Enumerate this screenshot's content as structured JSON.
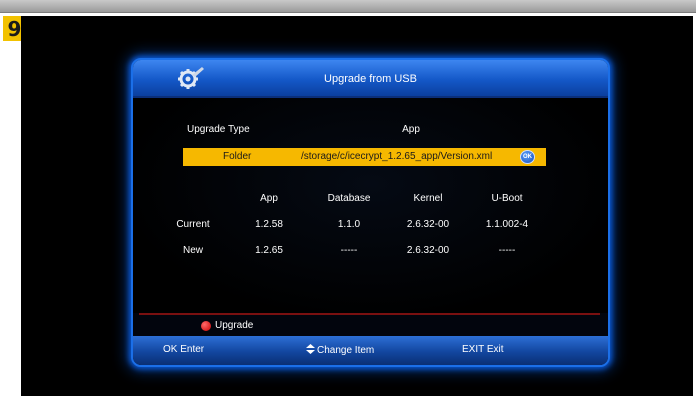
{
  "step_number": "9",
  "dialog": {
    "title": "Upgrade from USB",
    "upgrade_type_label": "Upgrade Type",
    "upgrade_type_value": "App",
    "folder_label": "Folder",
    "folder_path": "/storage/c/icecrypt_1.2.65_app/Version.xml",
    "ok_badge": "OK"
  },
  "version_table": {
    "columns": [
      "App",
      "Database",
      "Kernel",
      "U-Boot"
    ],
    "rows": [
      {
        "label": "Current",
        "values": [
          "1.2.58",
          "1.1.0",
          "2.6.32-00",
          "1.1.002-4"
        ]
      },
      {
        "label": "New",
        "values": [
          "1.2.65",
          "-----",
          "2.6.32-00",
          "-----"
        ]
      }
    ]
  },
  "hint": {
    "red_button_label": "Upgrade",
    "red_color": "#d00000"
  },
  "footer": {
    "enter": "OK Enter",
    "change_item": "Change Item",
    "exit": "EXIT Exit"
  },
  "colors": {
    "accent_blue": "#1b6fe8",
    "highlight": "#f6b800"
  }
}
